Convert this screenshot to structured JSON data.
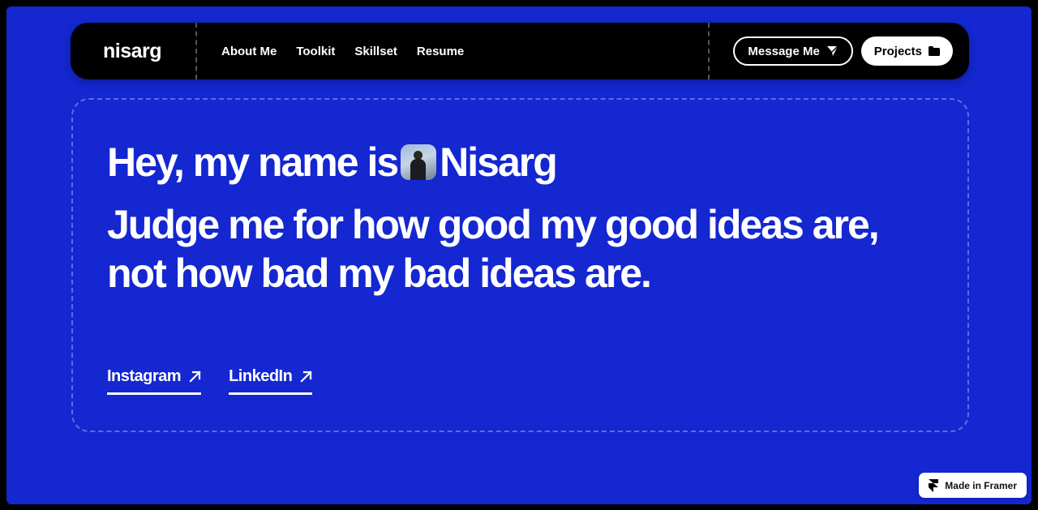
{
  "nav": {
    "brand": "nisarg",
    "links": [
      {
        "label": "About Me"
      },
      {
        "label": "Toolkit"
      },
      {
        "label": "Skillset"
      },
      {
        "label": "Resume"
      }
    ],
    "message_label": "Message Me",
    "message_icon": "send-icon",
    "projects_label": "Projects",
    "projects_icon": "folder-icon"
  },
  "hero": {
    "greeting_prefix": "Hey, my name is",
    "name": "Nisarg",
    "quote": "Judge me for how good my good ideas are, not how bad my bad ideas are."
  },
  "socials": [
    {
      "label": "Instagram",
      "icon": "arrow-up-right-icon"
    },
    {
      "label": "LinkedIn",
      "icon": "arrow-up-right-icon"
    }
  ],
  "badge": {
    "label": "Made in Framer",
    "icon": "framer-icon"
  },
  "colors": {
    "background": "#1427D0",
    "nav": "#000000",
    "text": "#FFFFFF"
  }
}
